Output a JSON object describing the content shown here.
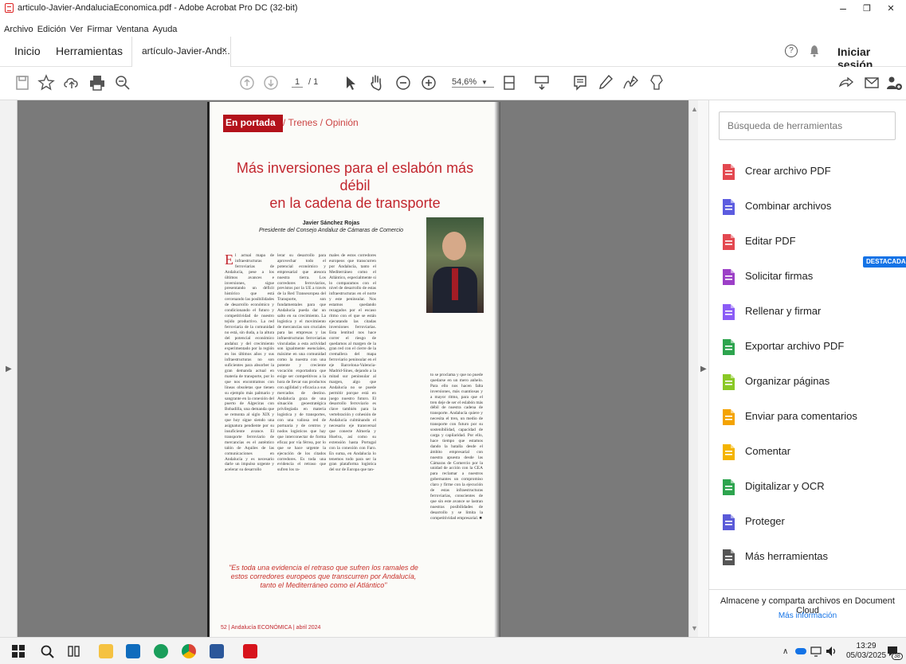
{
  "titlebar": {
    "title": "articulo-Javier-AndaluciaEconomica.pdf - Adobe Acrobat Pro DC (32-bit)",
    "minimize": "–",
    "restore": "❐",
    "close": "✕"
  },
  "menubar": [
    "Archivo",
    "Edición",
    "Ver",
    "Firmar",
    "Ventana",
    "Ayuda"
  ],
  "tabs": {
    "home": "Inicio",
    "tools": "Herramientas",
    "document": "artículo-Javier-And...",
    "close": "×",
    "help": "?",
    "signin": "Iniciar sesión"
  },
  "toolbar": {
    "page_current": "1",
    "page_total": "/ 1",
    "zoom": "54,6%"
  },
  "page": {
    "section": "En portada",
    "section_rest": "/ Trenes / Opinión",
    "headline_1": "Más inversiones para el eslabón más débil",
    "headline_2": "en la cadena de transporte",
    "author": "Javier Sánchez Rojas",
    "author_role": "Presidente del Consejo Andaluz de Cámaras de Comercio",
    "col1": "l actual mapa de infraestructuras ferroviarias de Andalucía, pese a los últimos avances e inversiones, sigue presentando un déficit histórico que está cercenando las posibilidades de desarrollo económico y condicionando el futuro y competitividad de nuestro tejido productivo. La red ferroviaria de la comunidad no está, sin duda, a la altura del potencial económico andaluz y del crecimiento experimentado por la región en los últimos años y sus infraestructuras no son suficientes para absorber la gran demanda actual en materia de transporte, por lo que nos encontramos con líneas obsoletas que tienen su ejemplo más palmario y sangrante en la conexión del puerto de Algeciras con Bobadilla, una demanda que se remonta al siglo XIX y que hoy sigue siendo una asignatura pendiente por su insuficiente avance. El transporte ferroviario de mercancías es el auténtico talón de Aquiles de las comunicaciones en Andalucía y es necesario darle un impulso urgente y acelerar su desarrollo",
    "col2": "lerar su desarrollo para aprovechar todo el potencial económico y empresarial que atesora nuestra tierra. Los corredores ferroviarios, previstos por la UE a través de la Red Transeuropea del Transporte, son fundamentales para que Andalucía pueda dar un salto en su crecimiento. La logística y el movimiento de mercancías son cruciales para las empresas y las infraestructuras ferroviarias vinculadas a esta actividad son igualmente esenciales, máxime en una comunidad como la nuestra con una potente y creciente vocación exportadora que exige ser competitivos a la hora de llevar sus productos con agilidad y eficacia a sus mercados de destino. Andalucía goza de una situación geoestratégica privilegiada en materia logística y de transportes, con una valiosa red de portuaria y de centros y nodos logísticos que hay que interconectar de forma eficaz por vía férrea, por lo que se hace urgente la ejecución de los citados corredores. Es toda una evidencia el retraso que sufren los ra-",
    "col3": "males de estos corredores europeos que transcurren por Andalucía, tanto el Mediterráneo como el Atlántico, especialmente si lo comparamos con el nivel de desarrollo de estas infraestructuras en el norte y este peninsular. Nos estamos quedando rezagados por el escaso ritmo con el que se están ejecutando las citadas inversiones ferroviarias. Esta lentitud nos hace correr el riesgo de quedarnos al margen de la gran red con el cierre de la cremallera del mapa ferroviario peninsular en el eje Barcelona-Valencia-Madrid-Sines, dejando a la mitad sur peninsular al margen, algo que Andalucía no se puede permitir porque está en juego nuestro futuro. El desarrollo ferroviario es clave también para la vertebración y cohesión de Andalucía culminando el necesario eje transversal que conecte Almería y Huelva, así como su extensión hasta Portugal con la conexión con Faro. En suma, en Andalucía lo tenemos todo para ser la gran plataforma logística del sur de Europa que tan-",
    "col4": "to se proclama y que no puede quedarse en un mero anhelo. Para ello nos hacen falta inversiones, más cuantiosas y a mayor ritmo, para que el tren deje de ser el eslabón más débil de nuestra cadena de transporte. Andalucía quiere y necesita el tren, un medio de transporte con futuro por su sostenibilidad, capacidad de carga y capilaridad. Por ello, hace tiempo que estamos dando la batalla desde el ámbito empresarial con nuestra apuesta desde las Cámaras de Comercio por la unidad de acción con la CEA para reclamar a nuestros gobernantes un compromiso claro y firme con la ejecución de estas infraestructuras ferroviarias, conscientes de que sin este avance se lastran nuestras posibilidades de desarrollo y se limita la competitividad empresarial. ■",
    "quote": "\"Es toda una evidencia el retraso que sufren los ramales de estos corredores europeos que transcurren por Andalucía, tanto el Mediterráneo como el Atlántico\"",
    "footer": "52 | Andalucía ECONÓMICA | abril 2024"
  },
  "panel": {
    "search_placeholder": "Búsqueda de herramientas",
    "badge": "DESTACADA",
    "tools": [
      {
        "label": "Crear archivo PDF",
        "icon": "create-pdf-icon",
        "color": "#e34850"
      },
      {
        "label": "Combinar archivos",
        "icon": "combine-files-icon",
        "color": "#5c5ce0"
      },
      {
        "label": "Editar PDF",
        "icon": "edit-pdf-icon",
        "color": "#e34850"
      },
      {
        "label": "Solicitar firmas",
        "icon": "request-signatures-icon",
        "color": "#9c3fc7"
      },
      {
        "label": "Rellenar y firmar",
        "icon": "fill-sign-icon",
        "color": "#8b5cf6"
      },
      {
        "label": "Exportar archivo PDF",
        "icon": "export-pdf-icon",
        "color": "#2da44e"
      },
      {
        "label": "Organizar páginas",
        "icon": "organize-pages-icon",
        "color": "#8ac926"
      },
      {
        "label": "Enviar para comentarios",
        "icon": "send-comments-icon",
        "color": "#f4a300"
      },
      {
        "label": "Comentar",
        "icon": "comment-icon",
        "color": "#f4b400"
      },
      {
        "label": "Digitalizar y OCR",
        "icon": "scan-ocr-icon",
        "color": "#2da44e"
      },
      {
        "label": "Proteger",
        "icon": "protect-icon",
        "color": "#5a5ad8"
      },
      {
        "label": "Más herramientas",
        "icon": "more-tools-icon",
        "color": "#555555"
      }
    ],
    "cloud_text": "Almacene y comparta archivos en Document Cloud",
    "cloud_link": "Más información"
  },
  "taskbar": {
    "time": "13:29",
    "date": "05/03/2025",
    "notifications": "38"
  }
}
